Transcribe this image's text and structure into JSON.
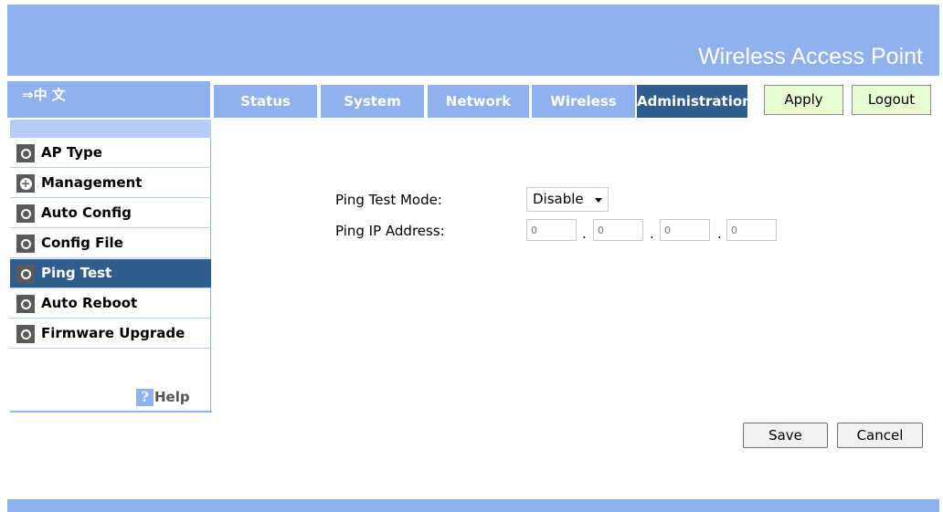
{
  "header": {
    "title": "Wireless Access Point"
  },
  "language": {
    "label": "⇒中 文"
  },
  "tabs": [
    {
      "label": "Status"
    },
    {
      "label": "System"
    },
    {
      "label": "Network"
    },
    {
      "label": "Wireless"
    },
    {
      "label": "Administration",
      "active": true
    }
  ],
  "nav_buttons": {
    "apply": "Apply",
    "logout": "Logout"
  },
  "sidebar": {
    "items": [
      {
        "label": "AP Type",
        "icon": "circle-icon"
      },
      {
        "label": "Management",
        "icon": "plus-icon"
      },
      {
        "label": "Auto Config",
        "icon": "circle-icon"
      },
      {
        "label": "Config File",
        "icon": "circle-icon"
      },
      {
        "label": "Ping Test",
        "icon": "circle-icon",
        "active": true
      },
      {
        "label": "Auto Reboot",
        "icon": "circle-icon"
      },
      {
        "label": "Firmware Upgrade",
        "icon": "circle-icon"
      }
    ],
    "help": {
      "icon": "?",
      "label": "Help"
    }
  },
  "form": {
    "mode_label": "Ping Test Mode:",
    "mode_value": "Disable",
    "ip_label": "Ping IP Address:",
    "ip_octets": [
      "0",
      "0",
      "0",
      "0"
    ],
    "separator": "."
  },
  "buttons": {
    "save": "Save",
    "cancel": "Cancel"
  },
  "colors": {
    "accent": "#8fb2ef",
    "active": "#2f5e8c",
    "nav_button_bg": "#e9fdd2"
  }
}
